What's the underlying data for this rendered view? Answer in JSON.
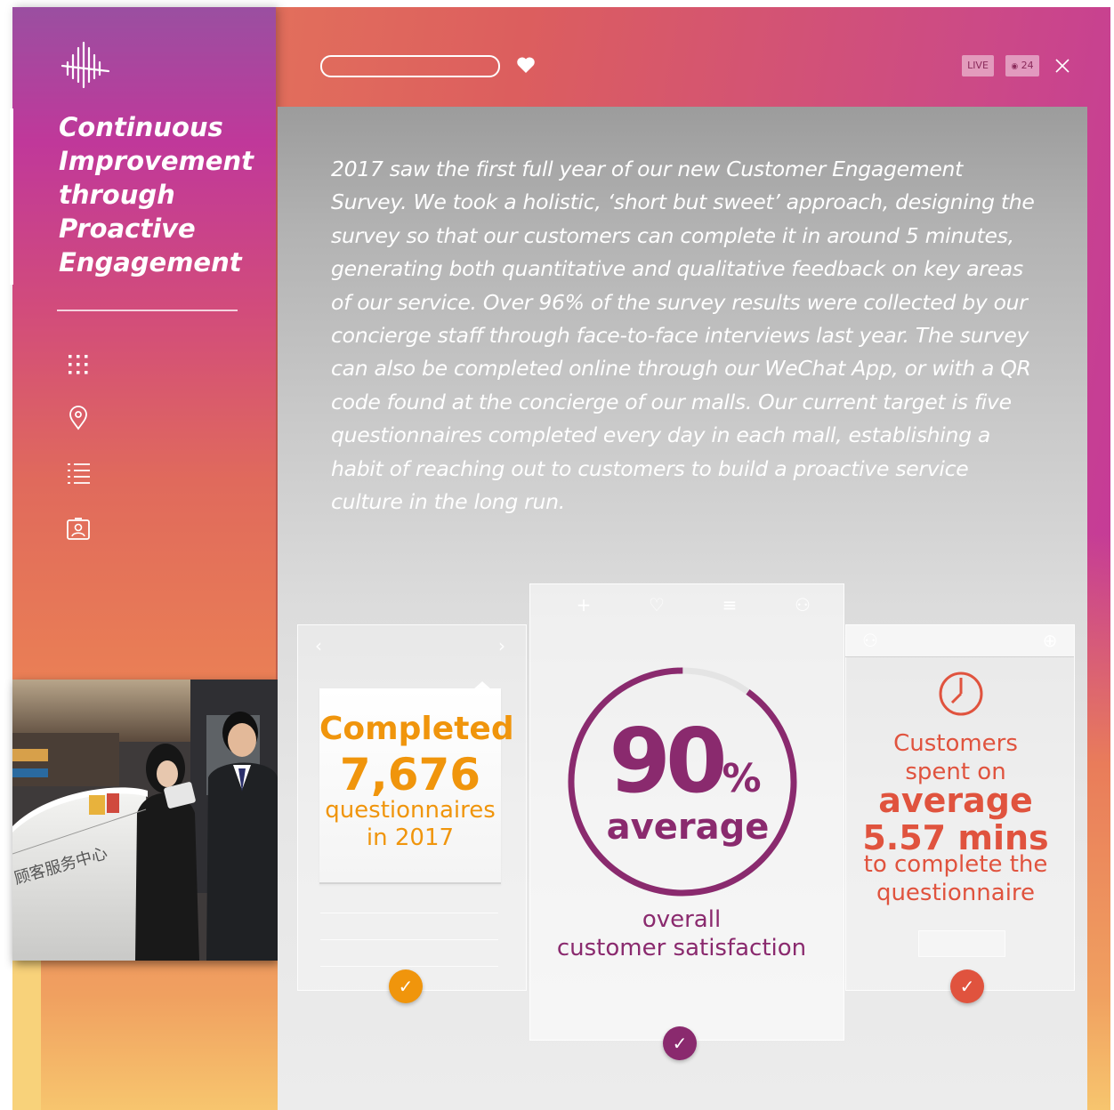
{
  "sidebar": {
    "title_lines": [
      "Continuous",
      "Improvement",
      "through",
      "Proactive",
      "Engagement"
    ],
    "nav_icons": [
      "grid-icon",
      "map-pin-icon",
      "list-icon",
      "profile-card-icon"
    ]
  },
  "header": {
    "live_badge": "LIVE",
    "viewers_count": "24",
    "icons": [
      "heart-icon",
      "eye-icon",
      "close-icon"
    ]
  },
  "intro_text": "2017 saw the first full year of our new Customer Engagement Survey. We took a holistic, ‘short but sweet’ approach, designing the survey so that our customers can complete it in around 5 minutes, generating both quantitative and qualitative feedback on key areas of our service. Over 96% of the survey results were collected by our concierge staff through face-to-face interviews last year. The survey can also be completed online through our WeChat App, or with a QR code found at the concierge of our malls. Our current target is five questionnaires completed every day in each mall, establishing a habit of reaching out to customers to build a proactive service culture in the long run.",
  "stats": {
    "questionnaires": {
      "label_top": "Completed",
      "value": "7,676",
      "label_line1": "questionnaires",
      "label_line2": "in 2017"
    },
    "satisfaction": {
      "value": "90",
      "unit": "%",
      "sub": "average",
      "ring_fraction": 0.9,
      "label_line1": "overall",
      "label_line2": "customer satisfaction"
    },
    "time": {
      "line1": "Customers",
      "line2": "spent on",
      "line3": "average",
      "line4": "5.57 mins",
      "line5": "to complete the",
      "line6": "questionnaire"
    }
  },
  "check_glyph": "✓",
  "colors": {
    "orange": "#f0950c",
    "purple": "#8a2a6e",
    "red": "#e0533e"
  }
}
